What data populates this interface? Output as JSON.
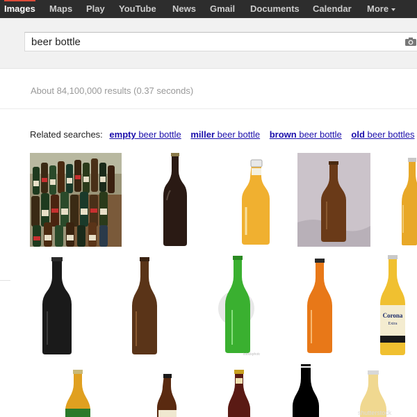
{
  "nav": {
    "items": [
      {
        "label": "Images"
      },
      {
        "label": "Maps"
      },
      {
        "label": "Play"
      },
      {
        "label": "YouTube"
      },
      {
        "label": "News"
      },
      {
        "label": "Gmail"
      },
      {
        "label": "Documents"
      },
      {
        "label": "Calendar"
      },
      {
        "label": "More"
      }
    ],
    "active_index": 0
  },
  "search": {
    "query": "beer bottle",
    "icon": "camera-icon"
  },
  "results": {
    "stats": "About 84,100,000 results (0.37 seconds)"
  },
  "related": {
    "label": "Related searches:",
    "items": [
      {
        "bold": "empty",
        "rest": " beer bottle"
      },
      {
        "bold": "miller",
        "rest": " beer bottle"
      },
      {
        "bold": "brown",
        "rest": " beer bottle"
      },
      {
        "bold": "old",
        "rest": " beer bottles"
      }
    ]
  },
  "thumbnails": [
    {
      "row": 1,
      "desc": "many beer bottles",
      "color": "#5a6a3a"
    },
    {
      "row": 1,
      "desc": "dark bottle",
      "color": "#2a1a12"
    },
    {
      "row": 1,
      "desc": "amber full bottle",
      "color": "#f0b030"
    },
    {
      "row": 1,
      "desc": "brown bottle on cloth",
      "color": "#6a3a18"
    },
    {
      "row": 1,
      "desc": "amber bottle partial",
      "color": "#e8a828"
    },
    {
      "row": 2,
      "desc": "black bottle",
      "color": "#1a1a1a"
    },
    {
      "row": 2,
      "desc": "brown glass bottle",
      "color": "#5a3418"
    },
    {
      "row": 2,
      "desc": "green bottle",
      "color": "#3ab030"
    },
    {
      "row": 2,
      "desc": "orange bottle",
      "color": "#e87818"
    },
    {
      "row": 2,
      "desc": "corona bottle",
      "color": "#f0c030"
    },
    {
      "row": 3,
      "desc": "heineken-style bottle",
      "color": "#e0a020"
    },
    {
      "row": 3,
      "desc": "brown bottle",
      "color": "#5a2a10"
    },
    {
      "row": 3,
      "desc": "dark red bottle",
      "color": "#5a1a14"
    },
    {
      "row": 3,
      "desc": "black silhouette bottle",
      "color": "#000000"
    },
    {
      "row": 3,
      "desc": "pale bottle",
      "color": "#f0d890"
    }
  ],
  "colors": {
    "topbar": "#2d2d2d",
    "nav_text": "#cccccc",
    "link": "#1a0dab",
    "stats": "#999999"
  }
}
